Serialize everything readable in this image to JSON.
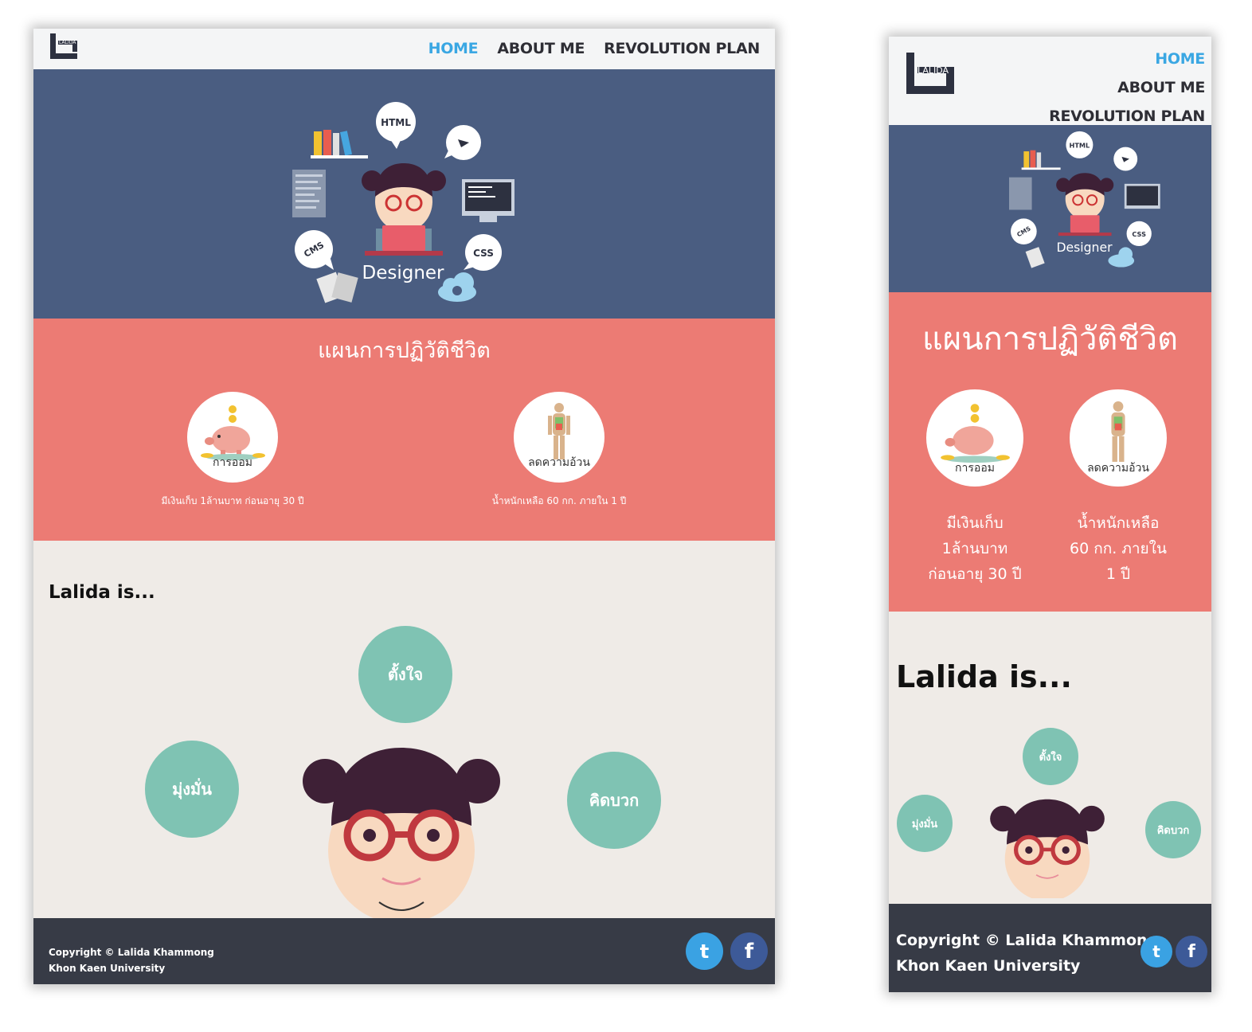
{
  "brand": {
    "logo_text": "LALIDA"
  },
  "nav": {
    "home": "HOME",
    "about": "ABOUT ME",
    "plan": "REVOLUTION PLAN"
  },
  "hero": {
    "illustration_caption": "Designer",
    "bubble_html": "HTML",
    "bubble_cms": "CMS",
    "bubble_css": "CSS"
  },
  "plan": {
    "title": "แผนการปฏิวัติชีวิต",
    "goals": [
      {
        "label": "การออม",
        "text": "มีเงินเก็บ 1ล้านบาท ก่อนอายุ 30 ปี",
        "icon": "piggy-bank-icon"
      },
      {
        "label": "ลดความอ้วน",
        "text": "น้ำหนักเหลือ 60 กก. ภายใน 1 ปี",
        "icon": "body-icon"
      }
    ]
  },
  "about": {
    "heading": "Lalida is...",
    "traits": [
      "ตั้งใจ",
      "มุ่งมั่น",
      "คิดบวก"
    ]
  },
  "footer": {
    "copyright": "Copyright © Lalida Khammong",
    "org": "Khon Kaen University",
    "twitter_glyph": "t",
    "facebook_glyph": "f"
  },
  "colors": {
    "nav_bg": "#f4f5f6",
    "nav_active": "#3aa7e3",
    "hero_bg": "#4a5d81",
    "plan_bg": "#ec7b74",
    "about_bg": "#efebe7",
    "trait_bg": "#7fc3b3",
    "footer_bg": "#373b46",
    "twitter": "#3aa2e3",
    "facebook": "#3d5a98"
  }
}
